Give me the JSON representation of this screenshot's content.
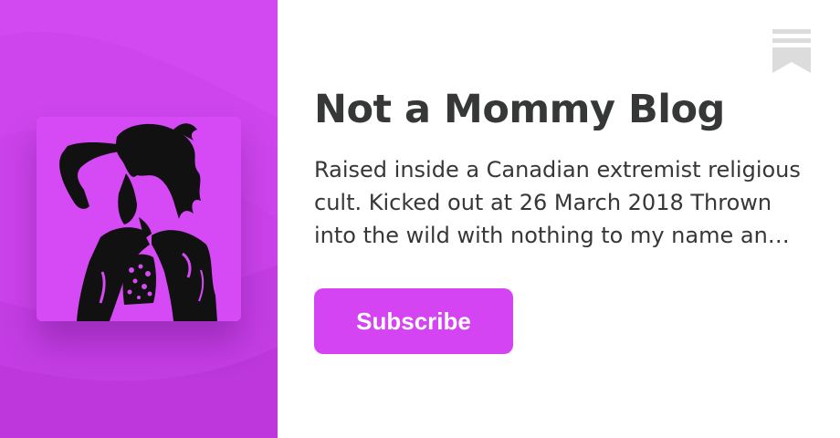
{
  "publication": {
    "title": "Not a Mommy Blog",
    "description": "Raised inside a Canadian extremist religious cult. Kicked out at 26 March 2018 Thrown into the wild with nothing to my name and no outside experience, this is my story of navigating a new life."
  },
  "actions": {
    "subscribe_label": "Subscribe"
  },
  "icons": {
    "logo": "bookmark-icon",
    "avatar": "woman-silhouette-image"
  },
  "colors": {
    "accent": "#d444f2",
    "left_panel": "#cc44ec",
    "avatar_background": "#d64af6",
    "avatar_ink": "#111111",
    "text": "#363737",
    "logo": "#dcdcdc"
  }
}
